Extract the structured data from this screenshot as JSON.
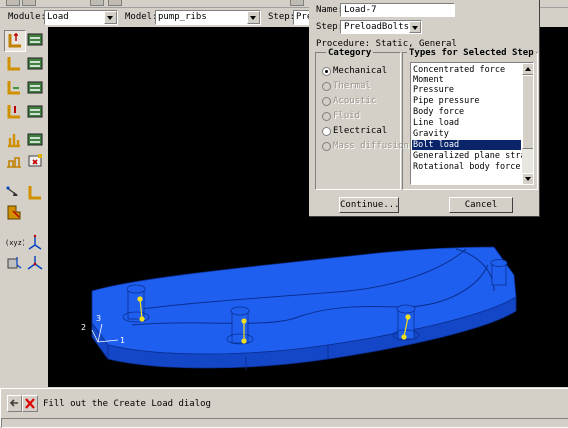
{
  "context_bar": {
    "module_label": "Module:",
    "module_value": "Load",
    "model_label": "Model:",
    "model_value": "pump_ribs",
    "step_label": "Step:",
    "step_value": "Pre"
  },
  "dialog": {
    "name_label": "Name:",
    "name_value": "Load-7",
    "step_label": "Step:",
    "step_value": "PreloadBolts",
    "procedure_text": "Procedure: Static, General",
    "category_title": "Category",
    "types_title": "Types for Selected Step",
    "categories": [
      {
        "label": "Mechanical",
        "selected": true,
        "enabled": true
      },
      {
        "label": "Thermal",
        "selected": false,
        "enabled": false
      },
      {
        "label": "Acoustic",
        "selected": false,
        "enabled": false
      },
      {
        "label": "Fluid",
        "selected": false,
        "enabled": false
      },
      {
        "label": "Electrical",
        "selected": false,
        "enabled": true
      },
      {
        "label": "Mass diffusion",
        "selected": false,
        "enabled": false
      }
    ],
    "types": [
      "Concentrated force",
      "Moment",
      "Pressure",
      "Pipe pressure",
      "Body force",
      "Line load",
      "Gravity",
      "Bolt load",
      "Generalized plane strain",
      "Rotational body force"
    ],
    "selected_type": "Bolt load",
    "continue_label": "Continue...",
    "cancel_label": "Cancel"
  },
  "viewport": {
    "triad_labels": [
      "2",
      "3",
      "1"
    ],
    "part_color": "#1a5cf0",
    "marker_color": "#f0e020"
  },
  "prompt": {
    "text": "Fill out the Create Load dialog"
  },
  "icons": [
    "back-arrow-icon",
    "close-x-icon",
    "create-load-icon",
    "load-manager-icon",
    "create-bc-icon",
    "bc-manager-icon",
    "create-field-icon",
    "field-manager-icon",
    "create-load-case-icon",
    "load-case-manager-icon",
    "create-predefined-field-icon",
    "predefined-field-manager-icon",
    "query-icon",
    "datum-csys-icon",
    "assign-csys-icon",
    "partition-icon",
    "axis-triad-icon"
  ]
}
